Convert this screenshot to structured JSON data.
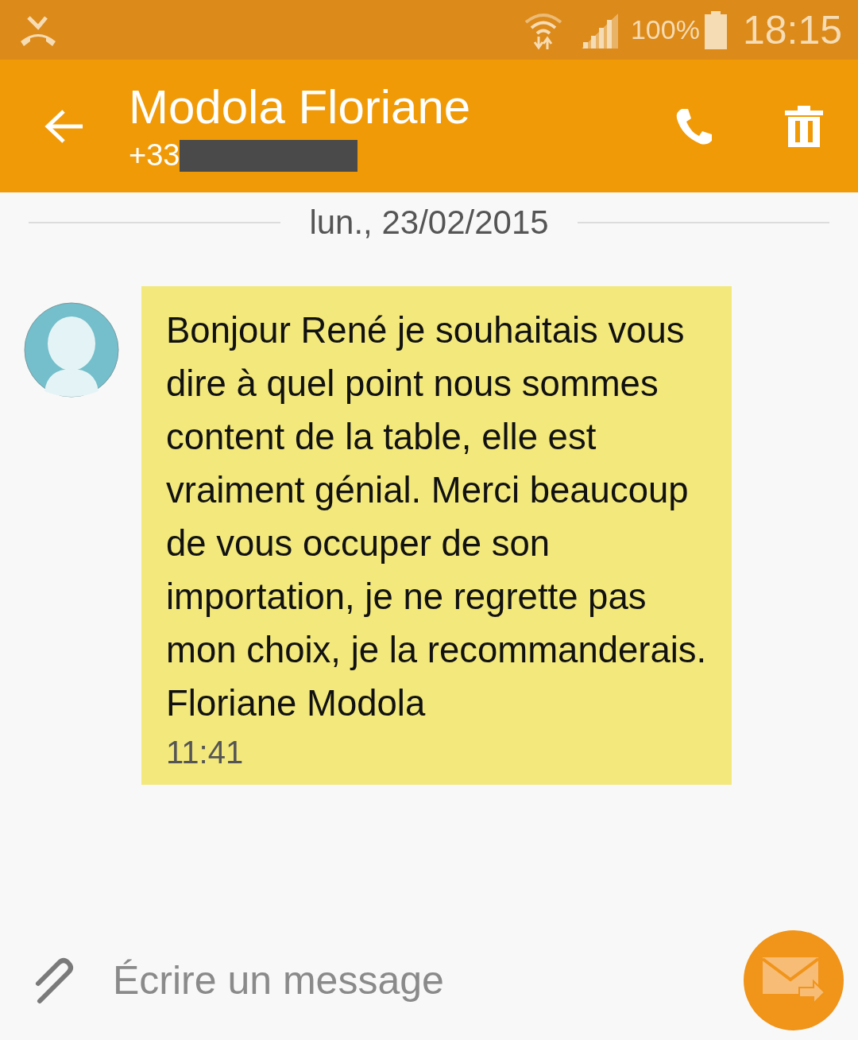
{
  "status_bar": {
    "battery": "100%",
    "time": "18:15"
  },
  "header": {
    "contact_name": "Modola Floriane",
    "phone_prefix": "+33"
  },
  "date_separator": "lun., 23/02/2015",
  "messages": [
    {
      "text": "Bonjour René je souhaitais vous dire à quel point nous sommes content de la table, elle est vraiment génial. Merci beaucoup de vous occuper de son importation, je ne regrette pas mon choix, je la recommanderais.\nFloriane Modola",
      "time": "11:41"
    }
  ],
  "composer": {
    "placeholder": "Écrire un message"
  }
}
